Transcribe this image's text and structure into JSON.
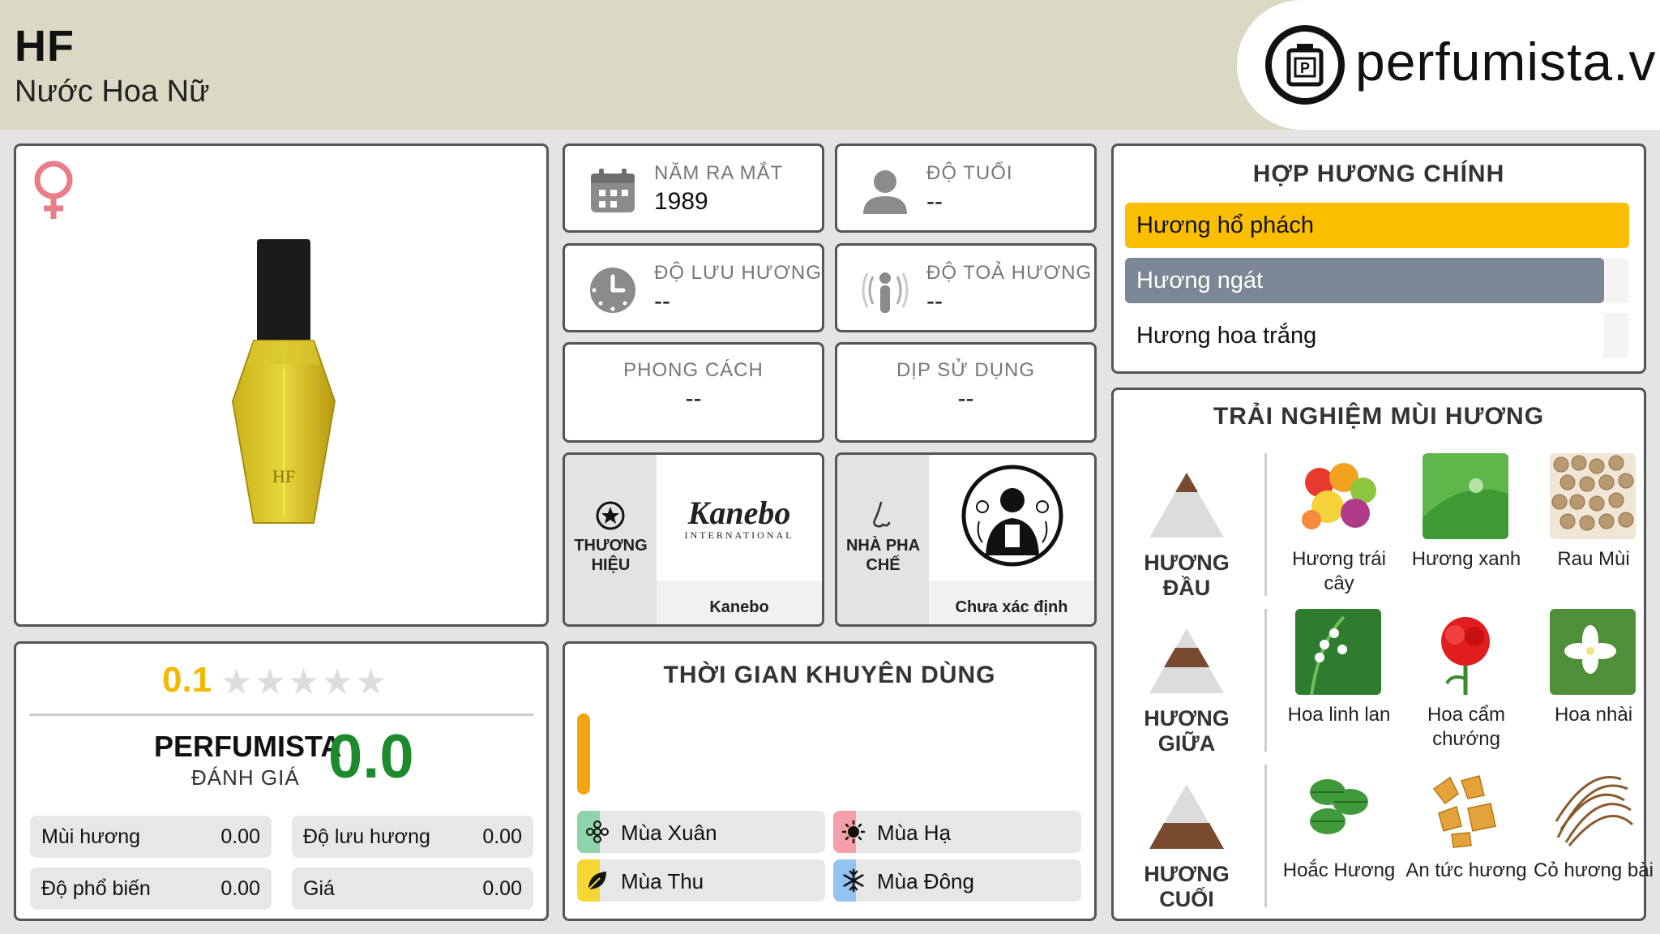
{
  "header": {
    "title": "HF",
    "subtitle": "Nước Hoa Nữ",
    "logo_text": "perfumista.vn"
  },
  "info": {
    "launch_year_label": "NĂM RA MẮT",
    "launch_year_value": "1989",
    "age_label": "ĐỘ TUỔI",
    "age_value": "--",
    "longevity_label": "ĐỘ LƯU HƯƠNG",
    "longevity_value": "--",
    "sillage_label": "ĐỘ TOẢ HƯƠNG",
    "sillage_value": "--",
    "style_label": "PHONG CÁCH",
    "style_value": "--",
    "occasion_label": "DỊP SỬ DỤNG",
    "occasion_value": "--"
  },
  "brand": {
    "label": "THƯƠNG HIỆU",
    "logo_text": "Kanebo",
    "logo_sub": "INTERNATIONAL",
    "name": "Kanebo"
  },
  "perfumer": {
    "label": "NHÀ PHA CHẾ",
    "name": "Chưa xác định"
  },
  "rating": {
    "user_score": "0.1",
    "stars": "★★★★★",
    "star_fill_fraction": 0.02,
    "brand_label": "PERFUMISTA",
    "brand_sub": "ĐÁNH GIÁ",
    "brand_score": "0.0",
    "metrics": [
      {
        "label": "Mùi hương",
        "value": "0.00"
      },
      {
        "label": "Độ lưu hương",
        "value": "0.00"
      },
      {
        "label": "Độ phổ biến",
        "value": "0.00"
      },
      {
        "label": "Giá",
        "value": "0.00"
      }
    ]
  },
  "seasons": {
    "title": "THỜI GIAN KHUYÊN DÙNG",
    "items": [
      {
        "label": "Mùa Xuân",
        "accent": "#8fd3a8",
        "icon": "flower-icon"
      },
      {
        "label": "Mùa Hạ",
        "accent": "#f4a0a8",
        "icon": "sun-icon"
      },
      {
        "label": "Mùa Thu",
        "accent": "#f7d733",
        "icon": "leaf-icon"
      },
      {
        "label": "Mùa Đông",
        "accent": "#93c4ef",
        "icon": "snowflake-icon"
      }
    ]
  },
  "accords": {
    "title": "HỢP HƯƠNG CHÍNH",
    "items": [
      {
        "label": "Hương hổ phách",
        "strength": 1.0,
        "color": "#fcbf00",
        "text_color": "#111111"
      },
      {
        "label": "Hương ngát",
        "strength": 0.95,
        "color": "#7b8794",
        "text_color": "#ffffff"
      },
      {
        "label": "Hương hoa trắng",
        "strength": 0.95,
        "color": "#ffffff",
        "text_color": "#111111"
      }
    ]
  },
  "notes": {
    "title": "TRẢI NGHIỆM MÙI HƯƠNG",
    "top_label": "HƯƠNG ĐẦU",
    "middle_label": "HƯƠNG GIỮA",
    "base_label": "HƯƠNG CUỐI",
    "top": [
      "Hương trái cây",
      "Hương xanh",
      "Rau Mùi"
    ],
    "middle": [
      "Hoa linh lan",
      "Hoa cẩm chướng",
      "Hoa nhài"
    ],
    "base": [
      "Hoắc Hương",
      "An tức hương",
      "Cỏ hương bài"
    ]
  },
  "colors": {
    "header_bg": "#dbd9c3",
    "accent_gold": "#f5b800",
    "score_green": "#1d8b2c",
    "gender_pink": "#e87f88"
  }
}
